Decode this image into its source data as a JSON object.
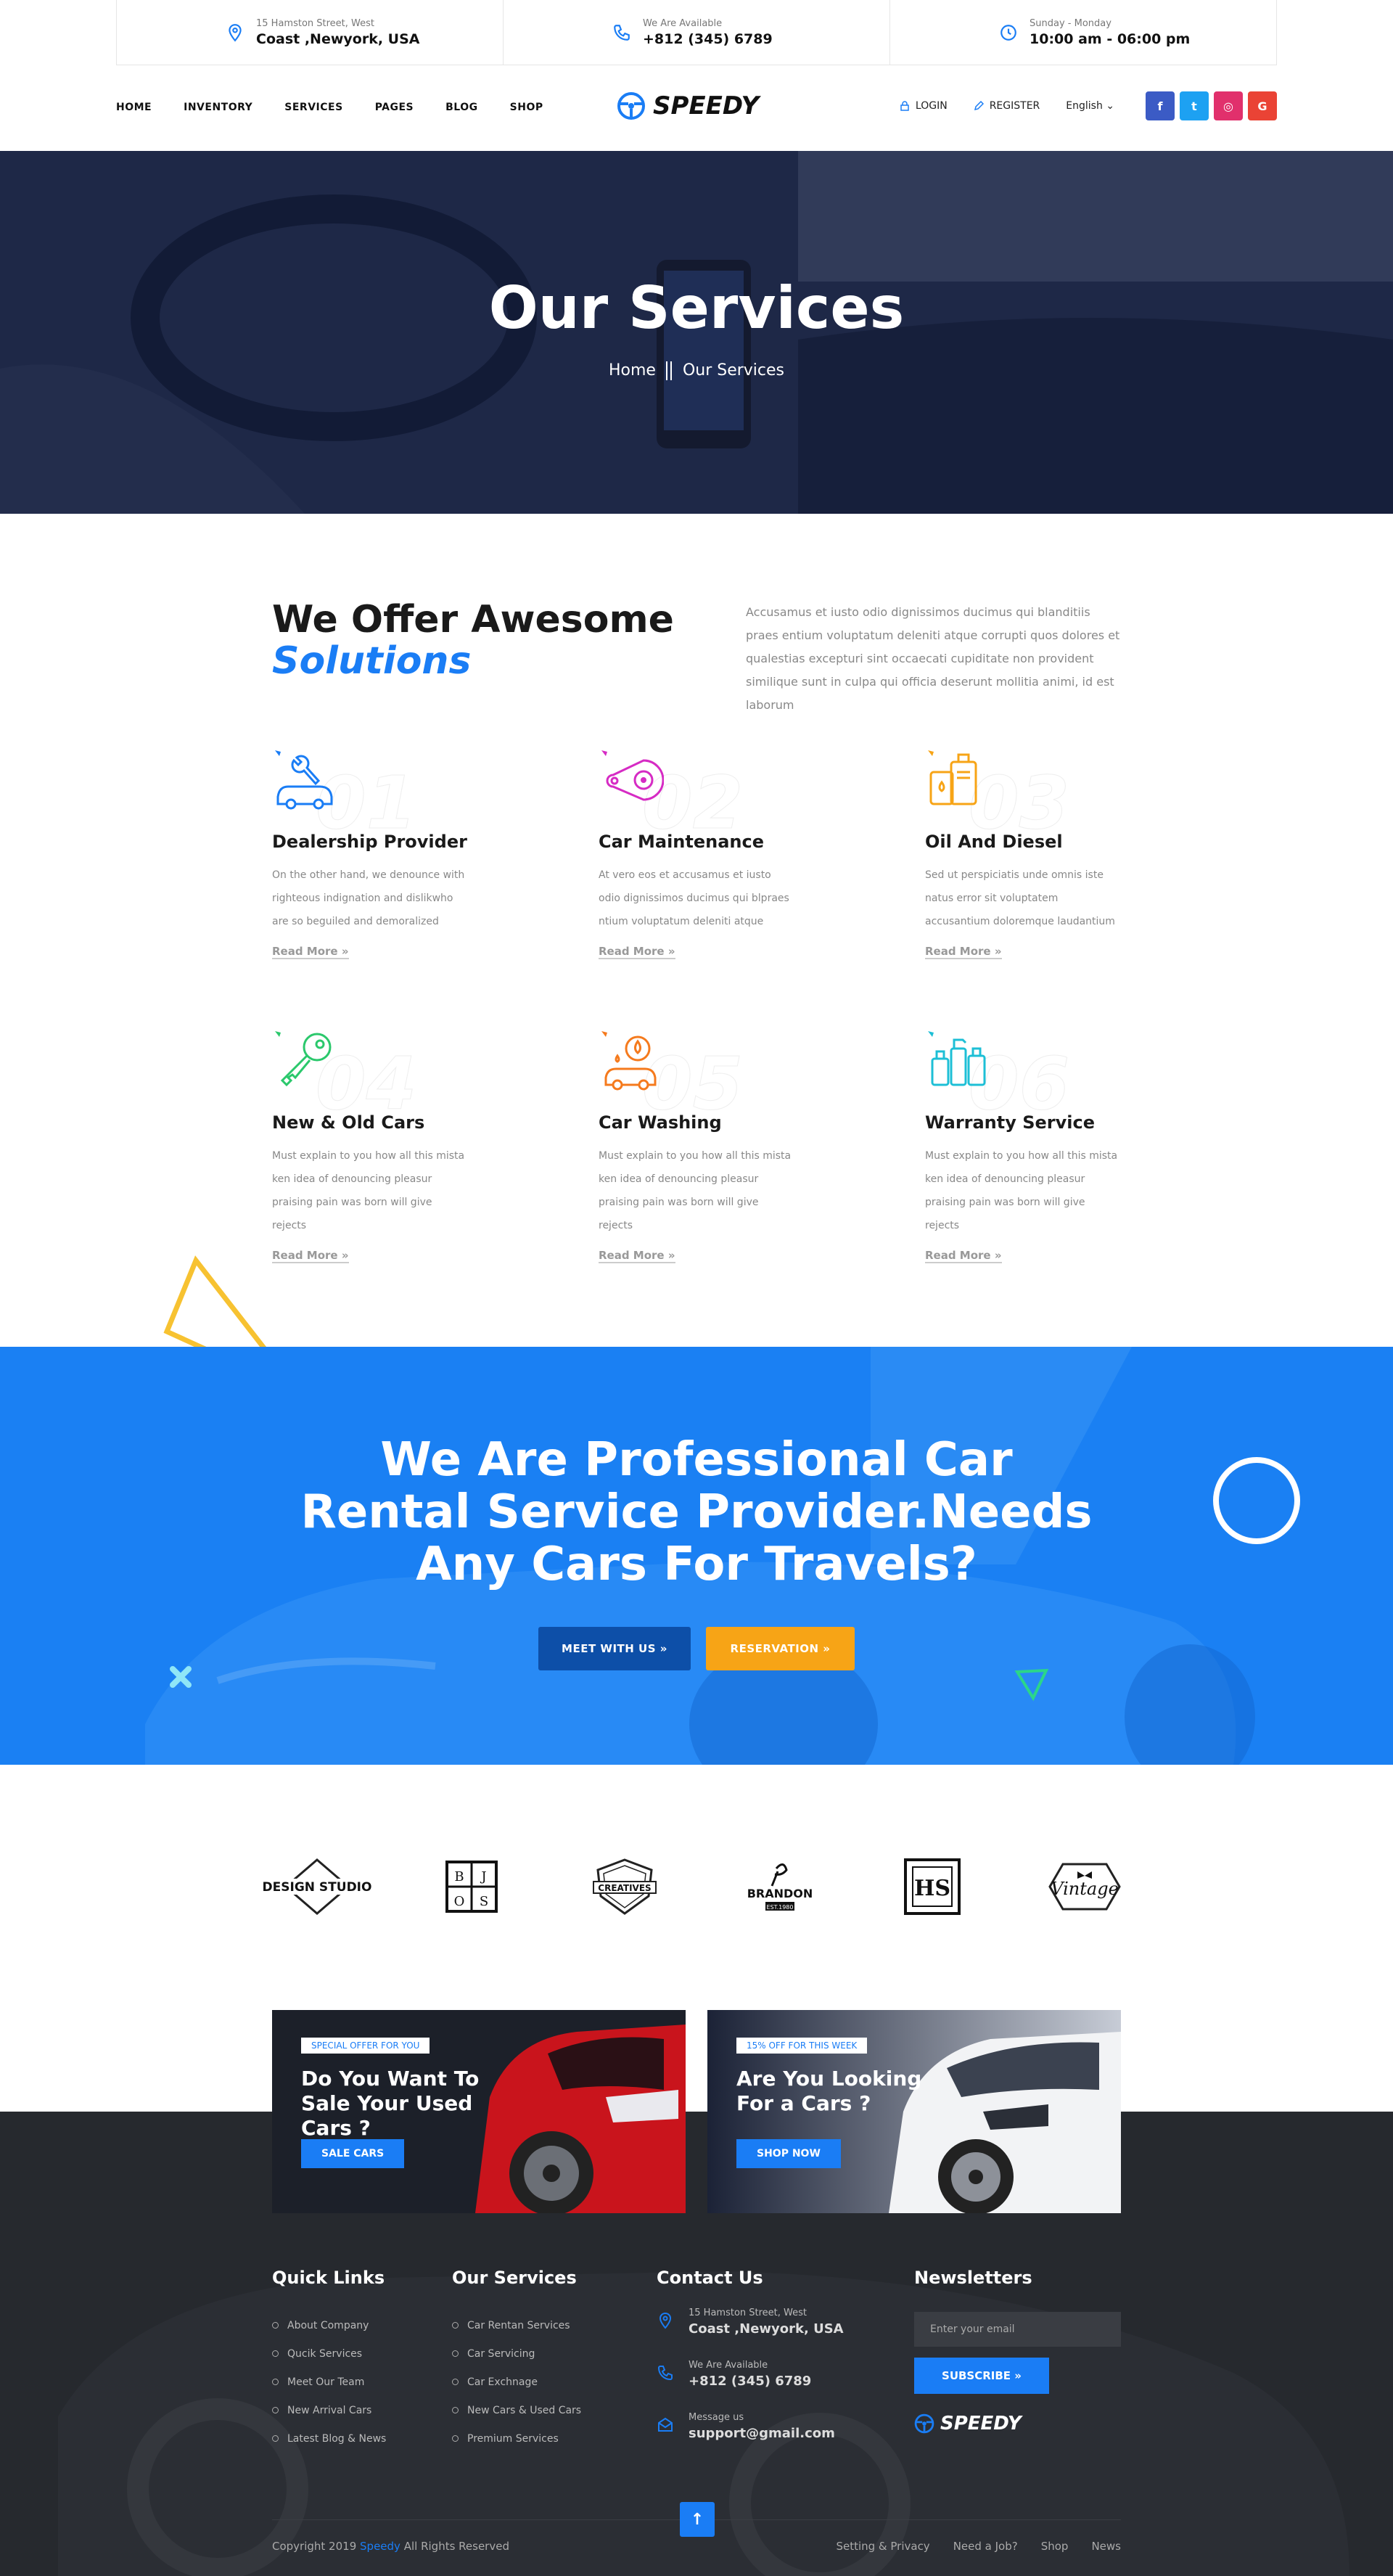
{
  "topbar": {
    "address": {
      "small": "15 Hamston Street, West",
      "big": "Coast ,Newyork, USA",
      "icon": "location-pin-icon"
    },
    "phone": {
      "small": "We Are Available",
      "big": "+812 (345) 6789",
      "icon": "phone-icon"
    },
    "hours": {
      "small": "Sunday - Monday",
      "big": "10:00 am - 06:00 pm",
      "icon": "clock-icon"
    }
  },
  "nav": {
    "items": [
      "HOME",
      "INVENTORY",
      "SERVICES",
      "PAGES",
      "BLOG",
      "SHOP"
    ],
    "logo": "SPEEDY",
    "login": "LOGIN",
    "register": "REGISTER",
    "language": "English ⌄",
    "social": [
      {
        "label": "f",
        "color": "#3b5bc5"
      },
      {
        "label": "t",
        "color": "#1da1f2"
      },
      {
        "label": "◎",
        "color": "#e1306c"
      },
      {
        "label": "G",
        "color": "#ea4335"
      }
    ]
  },
  "hero": {
    "title": "Our Services",
    "crumb_home": "Home",
    "crumb_current": "Our Services"
  },
  "intro": {
    "title_line1": "We Offer Awesome",
    "title_line2": "Solutions",
    "text": "Accusamus et iusto odio dignissimos ducimus qui blanditiis praes entium voluptatum deleniti atque corrupti quos dolores et qualestias excepturi sint occaecati cupiditate non provident similique sunt in culpa qui officia deserunt mollitia animi, id est laborum"
  },
  "services": [
    {
      "num": "01",
      "title": "Dealership Provider",
      "text": "On the other hand, we denounce with righteous indignation and dislikwho are so beguiled and demoralized",
      "more": "Read More »",
      "color": "#1a7df5",
      "icon": "car-wrench-icon"
    },
    {
      "num": "02",
      "title": "Car Maintenance",
      "text": "At vero eos et accusamus et iusto odio dignissimos ducimus qui blpraes ntium voluptatum deleniti atque",
      "more": "Read More »",
      "color": "#d62bc4",
      "icon": "timing-belt-icon"
    },
    {
      "num": "03",
      "title": "Oil And Diesel",
      "text": "Sed ut perspiciatis unde omnis iste natus error sit voluptatem accusantium doloremque laudantium",
      "more": "Read More »",
      "color": "#f7a416",
      "icon": "fuel-can-icon"
    },
    {
      "num": "04",
      "title": "New & Old Cars",
      "text": "Must explain to you how all this mista ken idea of denouncing pleasur praising pain was born will give rejects",
      "more": "Read More »",
      "color": "#2bc86c",
      "icon": "car-key-icon"
    },
    {
      "num": "05",
      "title": "Car Washing",
      "text": "Must explain to you how all this mista ken idea of denouncing pleasur praising pain was born will give rejects",
      "more": "Read More »",
      "color": "#f57a1d",
      "icon": "car-washing-icon"
    },
    {
      "num": "06",
      "title": "Warranty Service",
      "text": "Must explain to you how all this mista ken idea of denouncing pleasur praising pain was born will give rejects",
      "more": "Read More »",
      "color": "#1dbfd6",
      "icon": "spray-bottles-icon"
    }
  ],
  "cta": {
    "line1": "We Are Professional Car",
    "line2": "Rental Service Provider.Needs",
    "line3": "Any Cars For Travels?",
    "btn_meet": "MEET WITH US »",
    "btn_reserve": "RESERVATION »"
  },
  "brands": [
    {
      "name": "DESIGN STUDIO",
      "icon": "design-studio-logo"
    },
    {
      "name": "B J O S",
      "icon": "bjos-logo"
    },
    {
      "name": "CREATIVES",
      "icon": "creatives-logo"
    },
    {
      "name": "BRANDON",
      "sub": "EST.1980",
      "icon": "brandon-logo"
    },
    {
      "name": "HS",
      "icon": "hs-logo"
    },
    {
      "name": "Vintage",
      "icon": "vintage-logo"
    }
  ],
  "offers": [
    {
      "tag": "SPECIAL OFFER FOR YOU",
      "title": "Do You Want To Sale Your Used Cars ?",
      "button": "SALE CARS"
    },
    {
      "tag": "15% OFF FOR THIS WEEK",
      "title": "Are You Looking For a Cars ?",
      "button": "SHOP NOW"
    }
  ],
  "footer": {
    "quick_title": "Quick Links",
    "quick_links": [
      "About Company",
      "Qucik Services",
      "Meet Our Team",
      "New Arrival Cars",
      "Latest Blog & News"
    ],
    "services_title": "Our Services",
    "services_links": [
      "Car Rentan Services",
      "Car Servicing",
      "Car Exchnage",
      "New Cars & Used Cars",
      "Premium Services"
    ],
    "contact_title": "Contact Us",
    "contact": [
      {
        "small": "15 Hamston Street, West",
        "big": "Coast ,Newyork, USA",
        "icon": "location-pin-icon"
      },
      {
        "small": "We Are Available",
        "big": "+812 (345) 6789",
        "icon": "phone-icon"
      },
      {
        "small": "Message us",
        "big": "support@gmail.com",
        "icon": "envelope-icon"
      }
    ],
    "newsletter_title": "Newsletters",
    "email_placeholder": "Enter your email",
    "subscribe": "SUBSCRIBE »",
    "logo": "SPEEDY",
    "copyright_pre": "Copyright  2019",
    "copyright_brand": "Speedy",
    "copyright_post": "All Rights Reserved",
    "bottom_links": [
      "Setting & Privacy",
      "Need a Job?",
      "Shop",
      "News"
    ],
    "to_top": "↑"
  }
}
